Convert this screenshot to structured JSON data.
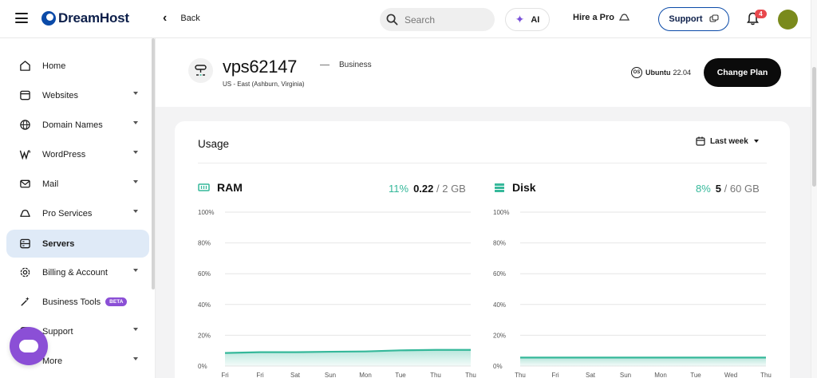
{
  "topbar": {
    "brand": "DreamHost",
    "back_label": "Back",
    "search_placeholder": "Search",
    "ai_label": "AI",
    "hire_label": "Hire a Pro",
    "support_label": "Support",
    "notification_count": "4"
  },
  "sidebar": {
    "items": [
      {
        "label": "Home",
        "icon": "home-icon",
        "has_caret": false,
        "active": false
      },
      {
        "label": "Websites",
        "icon": "browser-icon",
        "has_caret": true,
        "active": false
      },
      {
        "label": "Domain Names",
        "icon": "globe-icon",
        "has_caret": true,
        "active": false
      },
      {
        "label": "WordPress",
        "icon": "wordpress-icon",
        "has_caret": true,
        "active": false
      },
      {
        "label": "Mail",
        "icon": "mail-icon",
        "has_caret": true,
        "active": false
      },
      {
        "label": "Pro Services",
        "icon": "hat-icon",
        "has_caret": true,
        "active": false
      },
      {
        "label": "Servers",
        "icon": "server-icon",
        "has_caret": false,
        "active": true
      },
      {
        "label": "Billing & Account",
        "icon": "gear-icon",
        "has_caret": true,
        "active": false
      },
      {
        "label": "Business Tools",
        "icon": "magic-wand-icon",
        "has_caret": false,
        "active": false,
        "badge": "BETA"
      },
      {
        "label": "Support",
        "icon": "chat-icon",
        "has_caret": true,
        "active": false
      },
      {
        "label": "More",
        "icon": "more-icon",
        "has_caret": true,
        "active": false
      }
    ]
  },
  "server": {
    "name": "vps62147",
    "location": "US - East (Ashburn, Virginia)",
    "plan": "Business",
    "os_name": "Ubuntu",
    "os_version": "22.04",
    "change_plan_label": "Change Plan"
  },
  "usage": {
    "title": "Usage",
    "range_label": "Last week",
    "ram": {
      "title": "RAM",
      "percent": "11%",
      "used": "0.22",
      "total": "/ 2 GB"
    },
    "disk": {
      "title": "Disk",
      "percent": "8%",
      "used": "5",
      "total": "/ 60 GB"
    }
  },
  "chart_data": [
    {
      "type": "area",
      "title": "RAM",
      "x": [
        "Fri",
        "Fri",
        "Sat",
        "Sun",
        "Mon",
        "Tue",
        "Thu",
        "Thu"
      ],
      "values": [
        8.5,
        9,
        9,
        9.3,
        9.5,
        10.2,
        10.5,
        10.5
      ],
      "ylim": [
        0,
        100
      ],
      "yticks": [
        "100%",
        "80%",
        "60%",
        "40%",
        "20%",
        "0%"
      ],
      "color": "#35b89a"
    },
    {
      "type": "area",
      "title": "Disk",
      "x": [
        "Thu",
        "Fri",
        "Sat",
        "Sun",
        "Mon",
        "Tue",
        "Wed",
        "Thu"
      ],
      "values": [
        5.5,
        5.5,
        5.5,
        5.5,
        5.5,
        5.5,
        5.5,
        5.5
      ],
      "ylim": [
        0,
        100
      ],
      "yticks": [
        "100%",
        "80%",
        "60%",
        "40%",
        "20%",
        "0%"
      ],
      "color": "#35b89a"
    }
  ]
}
